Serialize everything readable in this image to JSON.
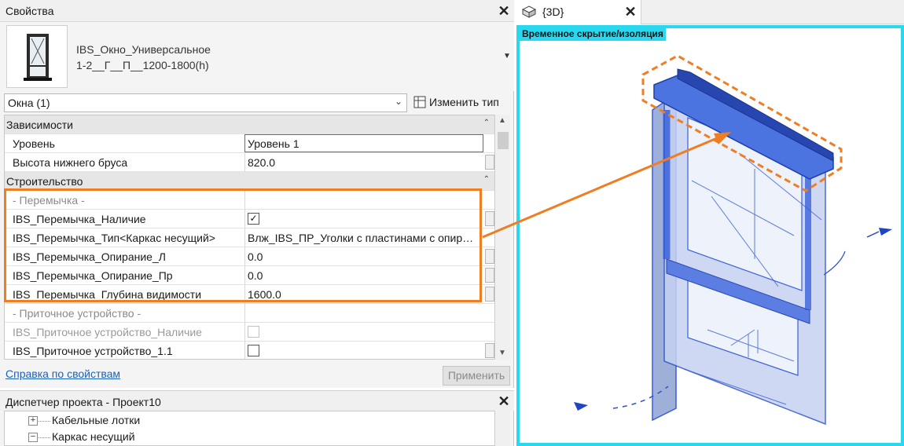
{
  "properties": {
    "title": "Свойства",
    "type_name_line1": "IBS_Окно_Универсальное",
    "type_name_line2": "1-2__Г__П__1200-1800(h)",
    "family_select_value": "Окна (1)",
    "edit_type_label": "Изменить тип",
    "groups": {
      "constraints": "Зависимости",
      "construction": "Строительство"
    },
    "rows": {
      "level": {
        "name": "Уровень",
        "value": "Уровень 1"
      },
      "sill_height": {
        "name": "Высота нижнего бруса",
        "value": "820.0"
      },
      "lintel_header": {
        "name": "- Перемычка -",
        "value": ""
      },
      "lintel_presence": {
        "name": "IBS_Перемычка_Наличие",
        "checked": true
      },
      "lintel_type": {
        "name": "IBS_Перемычка_Тип<Каркас несущий>",
        "value": "Влж_IBS_ПР_Уголки с пластинами с опир…"
      },
      "lintel_support_l": {
        "name": "IBS_Перемычка_Опирание_Л",
        "value": "0.0"
      },
      "lintel_support_r": {
        "name": "IBS_Перемычка_Опирание_Пр",
        "value": "0.0"
      },
      "lintel_depth": {
        "name": "IBS_Перемычка_Глубина видимости",
        "value": "1600.0"
      },
      "vent_header": {
        "name": "- Приточное устройство -",
        "value": ""
      },
      "vent_presence": {
        "name": "IBS_Приточное устройство_Наличие",
        "checked": false
      },
      "vent_1_1": {
        "name": "IBS_Приточное устройство_1.1",
        "checked": false
      }
    },
    "help_link": "Справка по свойствам",
    "apply_button": "Применить"
  },
  "project_browser": {
    "title": "Диспетчер проекта - Проект10",
    "items": [
      "Кабельные лотки",
      "Каркас несущий"
    ],
    "expanders": [
      "+",
      "−"
    ]
  },
  "view": {
    "tab_label": "{3D}",
    "isolation_badge": "Временное скрытие/изоляция"
  },
  "colors": {
    "accent_orange": "#ef7d22",
    "isolation_cyan": "#29d8ee",
    "window_blue": "#3a5fd8",
    "link_blue": "#1c62b9"
  },
  "icons": [
    "window-thumbnail-icon",
    "edit-type-icon",
    "chevron-down-icon",
    "close-icon",
    "collapse-icon",
    "checkbox-icon",
    "3d-view-icon",
    "view-cube-arrow-icon"
  ]
}
